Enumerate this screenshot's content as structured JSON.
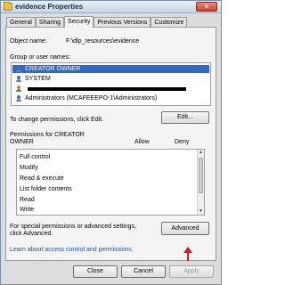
{
  "window": {
    "title": "evidence Properties",
    "close_glyph": "✕"
  },
  "tabs": [
    {
      "label": "General",
      "active": false
    },
    {
      "label": "Sharing",
      "active": false
    },
    {
      "label": "Security",
      "active": true
    },
    {
      "label": "Previous Versions",
      "active": false
    },
    {
      "label": "Customize",
      "active": false
    }
  ],
  "security": {
    "object_name_label": "Object name:",
    "object_name_value": "F:\\dlp_resources\\evidence",
    "group_label": "Group or user names:",
    "users": [
      {
        "name": "CREATOR OWNER",
        "selected": true
      },
      {
        "name": "SYSTEM",
        "selected": false
      },
      {
        "name": "",
        "selected": false
      },
      {
        "name": "Administrators (MCAFEEEPO-1\\Administrators)",
        "selected": false
      }
    ],
    "change_text": "To change permissions, click Edit.",
    "edit_button": "Edit...",
    "perm_header_line1": "Permissions for CREATOR",
    "perm_header_line2": "OWNER",
    "allow_label": "Allow",
    "deny_label": "Deny",
    "permissions": [
      "Full control",
      "Modify",
      "Read & execute",
      "List folder contents",
      "Read",
      "Write"
    ],
    "special_text_line1": "For special permissions or advanced settings,",
    "special_text_line2": "click Advanced.",
    "advanced_button": "Advanced",
    "learn_link": "Learn about access control and permissions"
  },
  "footer": {
    "close_button": "Close",
    "cancel_button": "Cancel",
    "apply_button": "Apply"
  },
  "colors": {
    "selection": "#3068c8",
    "annotation_arrow": "#d41a1a",
    "link": "#1a50b8"
  }
}
